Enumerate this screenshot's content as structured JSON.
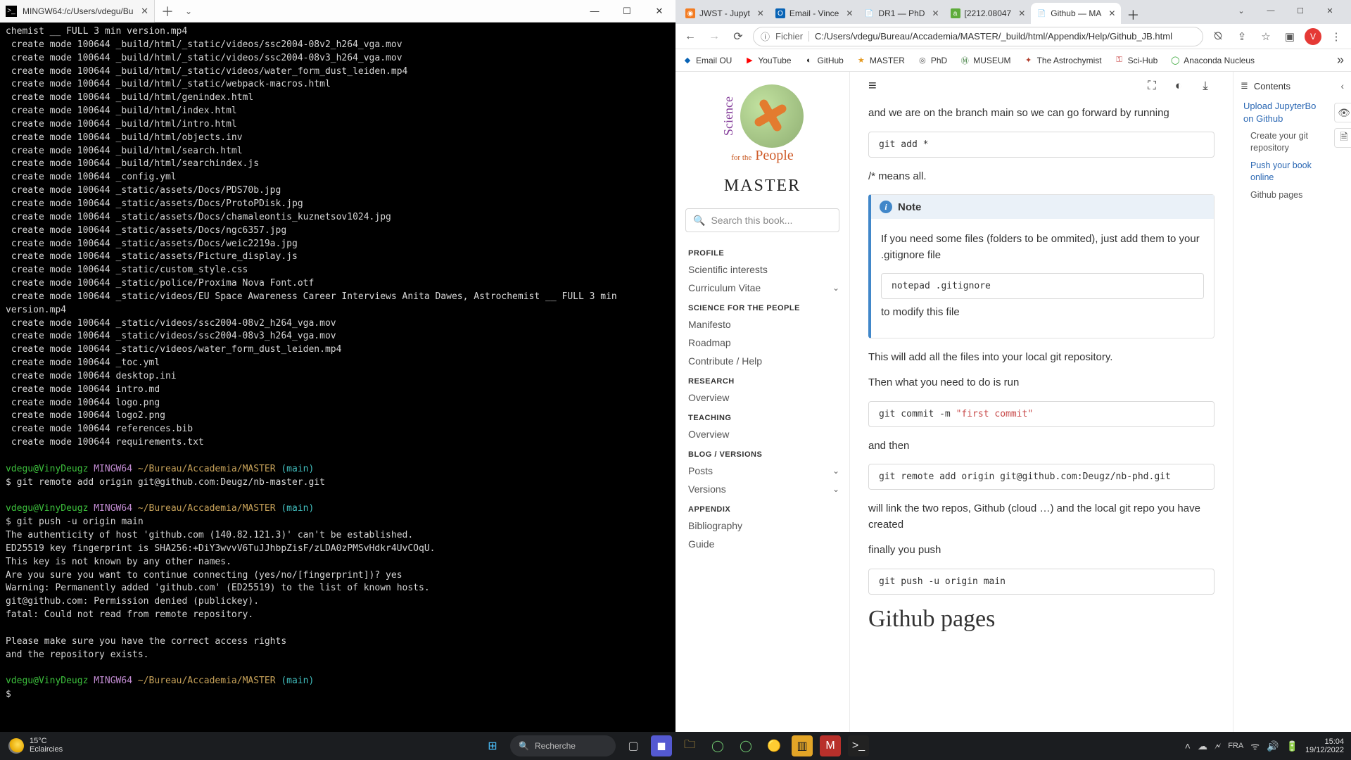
{
  "terminal": {
    "tab_title": "MINGW64:/c/Users/vdegu/Bu",
    "prompt": {
      "user": "vdegu@VinyDeugz",
      "sys": "MINGW64",
      "path": "~/Bureau/Accademia/MASTER",
      "branch": "(main)"
    },
    "cmd_remote": "git remote add origin git@github.com:Deugz/nb-master.git",
    "cmd_push": "git push -u origin main",
    "lines_top": [
      "chemist __ FULL 3 min version.mp4",
      " create mode 100644 _build/html/_static/videos/ssc2004-08v2_h264_vga.mov",
      " create mode 100644 _build/html/_static/videos/ssc2004-08v3_h264_vga.mov",
      " create mode 100644 _build/html/_static/videos/water_form_dust_leiden.mp4",
      " create mode 100644 _build/html/_static/webpack-macros.html",
      " create mode 100644 _build/html/genindex.html",
      " create mode 100644 _build/html/index.html",
      " create mode 100644 _build/html/intro.html",
      " create mode 100644 _build/html/objects.inv",
      " create mode 100644 _build/html/search.html",
      " create mode 100644 _build/html/searchindex.js",
      " create mode 100644 _config.yml",
      " create mode 100644 _static/assets/Docs/PDS70b.jpg",
      " create mode 100644 _static/assets/Docs/ProtoPDisk.jpg",
      " create mode 100644 _static/assets/Docs/chamaleontis_kuznetsov1024.jpg",
      " create mode 100644 _static/assets/Docs/ngc6357.jpg",
      " create mode 100644 _static/assets/Docs/weic2219a.jpg",
      " create mode 100644 _static/assets/Picture_display.js",
      " create mode 100644 _static/custom_style.css",
      " create mode 100644 _static/police/Proxima Nova Font.otf",
      " create mode 100644 _static/videos/EU Space Awareness Career Interviews Anita Dawes, Astrochemist __ FULL 3 min version.mp4",
      " create mode 100644 _static/videos/ssc2004-08v2_h264_vga.mov",
      " create mode 100644 _static/videos/ssc2004-08v3_h264_vga.mov",
      " create mode 100644 _static/videos/water_form_dust_leiden.mp4",
      " create mode 100644 _toc.yml",
      " create mode 100644 desktop.ini",
      " create mode 100644 intro.md",
      " create mode 100644 logo.png",
      " create mode 100644 logo2.png",
      " create mode 100644 references.bib",
      " create mode 100644 requirements.txt"
    ],
    "lines_push": [
      "The authenticity of host 'github.com (140.82.121.3)' can't be established.",
      "ED25519 key fingerprint is SHA256:+DiY3wvvV6TuJJhbpZisF/zLDA0zPMSvHdkr4UvCOqU.",
      "This key is not known by any other names.",
      "Are you sure you want to continue connecting (yes/no/[fingerprint])? yes",
      "Warning: Permanently added 'github.com' (ED25519) to the list of known hosts.",
      "git@github.com: Permission denied (publickey).",
      "fatal: Could not read from remote repository.",
      "",
      "Please make sure you have the correct access rights",
      "and the repository exists."
    ],
    "cursor": "$ "
  },
  "browser": {
    "tabs": [
      {
        "label": "JWST - Jupyt"
      },
      {
        "label": "Email - Vince"
      },
      {
        "label": "DR1 — PhD"
      },
      {
        "label": "[2212.08047"
      },
      {
        "label": "Github — MA",
        "active": true
      }
    ],
    "url_scheme": "Fichier",
    "url": "C:/Users/vdegu/Bureau/Accademia/MASTER/_build/html/Appendix/Help/Github_JB.html",
    "avatar_letter": "V",
    "bookmarks": [
      "Email OU",
      "YouTube",
      "GitHub",
      "MASTER",
      "PhD",
      "MUSEUM",
      "The Astrochymist",
      "Sci-Hub",
      "Anaconda Nucleus"
    ]
  },
  "page": {
    "logo_text_top": "Science",
    "logo_text_for": "for the",
    "logo_text_people": "People",
    "master": "MASTER",
    "search_placeholder": "Search this book...",
    "sections": {
      "profile": {
        "title": "PROFILE",
        "items": [
          "Scientific interests",
          "Curriculum Vitae"
        ]
      },
      "sftp": {
        "title": "SCIENCE FOR THE PEOPLE",
        "items": [
          "Manifesto",
          "Roadmap",
          "Contribute / Help"
        ]
      },
      "research": {
        "title": "RESEARCH",
        "items": [
          "Overview"
        ]
      },
      "teaching": {
        "title": "TEACHING",
        "items": [
          "Overview"
        ]
      },
      "blog": {
        "title": "BLOG / VERSIONS",
        "items": [
          "Posts",
          "Versions"
        ]
      },
      "appendix": {
        "title": "APPENDIX",
        "items": [
          "Bibliography",
          "Guide"
        ]
      }
    },
    "content": {
      "intro_trail": "and we are on the branch main so we can go forward by running",
      "code_add": "git add *",
      "means_all": "/* means all.",
      "note_title": "Note",
      "note_p1": "If you need some files (folders to be ommited), just add them to your .gitignore file",
      "note_code": "notepad .gitignore",
      "note_p2": "to modify this file",
      "p_addfiles": "This will add all the files into your local git repository.",
      "p_then": "Then what you need to do is run",
      "code_commit_pre": "git commit -m ",
      "code_commit_str": "\"first commit\"",
      "p_andthen": "and then",
      "code_remote": "git remote add origin git@github.com:Deugz/nb-phd.git",
      "p_link": "will link the two repos, Github (cloud …) and the local git repo you have created",
      "p_finally": "finally you push",
      "code_push": "git push -u origin main",
      "gh_pages": "Github pages"
    },
    "toc": {
      "head": "Contents",
      "i0": "Upload JupyterBo",
      "i0b": "on Github",
      "i1": "Create your git",
      "i1b": "repository",
      "i2": "Push your book",
      "i2b": "online",
      "i3": "Github pages"
    }
  },
  "taskbar": {
    "temp": "15°C",
    "weather": "Eclaircies",
    "search": "Recherche",
    "time": "15:04",
    "date": "19/12/2022"
  }
}
